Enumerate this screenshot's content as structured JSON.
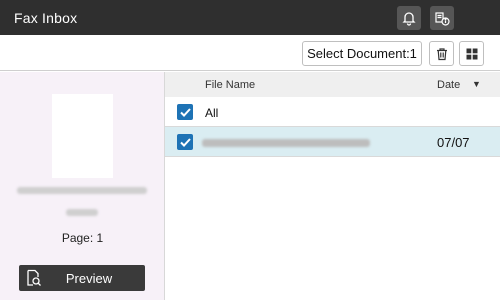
{
  "window": {
    "title": "Fax Inbox"
  },
  "header_icons": [
    "bell-icon",
    "fax-info-icon"
  ],
  "toolbar": {
    "select_document_label": "Select Document:1",
    "delete_icon": "trash-icon",
    "view_icon": "grid-view-icon"
  },
  "preview_panel": {
    "page_label": "Page:  1",
    "preview_button_label": "Preview",
    "preview_icon": "document-magnifier-icon"
  },
  "file_list": {
    "columns": [
      "File Name",
      "Date"
    ],
    "sort_indicator": "▼",
    "all_label": "All",
    "all_checked": true,
    "rows": [
      {
        "date": "07/07",
        "checked": true,
        "selected": true
      }
    ]
  },
  "colors": {
    "titlebar": "#2f2f2f",
    "checkbox": "#1e73b5",
    "selected_row": "#daedf2",
    "left_panel": "#f7f1f8",
    "preview_button": "#3a3a3a"
  }
}
